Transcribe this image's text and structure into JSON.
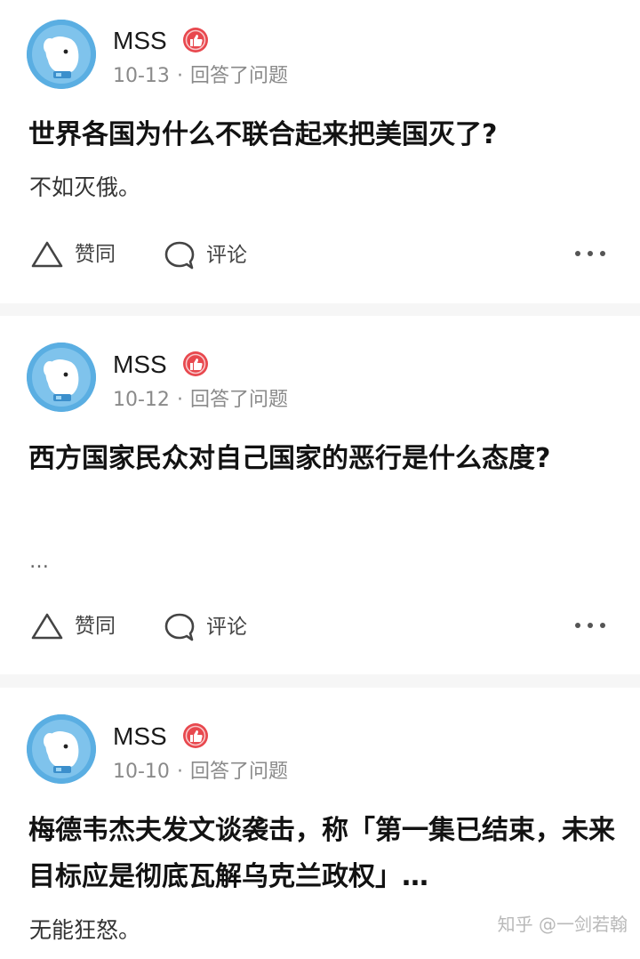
{
  "feed": [
    {
      "author": "MSS",
      "date": "10-13",
      "dot": "·",
      "action_text": "回答了问题",
      "question": "世界各国为什么不联合起来把美国灭了?",
      "excerpt": "不如灭俄。",
      "like_label": "赞同",
      "comment_label": "评论"
    },
    {
      "author": "MSS",
      "date": "10-12",
      "dot": "·",
      "action_text": "回答了问题",
      "question": "西方国家民众对自己国家的恶行是什么态度?",
      "excerpt": "…",
      "like_label": "赞同",
      "comment_label": "评论"
    },
    {
      "author": "MSS",
      "date": "10-10",
      "dot": "·",
      "action_text": "回答了问题",
      "question": "梅德韦杰夫发文谈袭击，称「第一集已结束，未来目标应是彻底瓦解乌克兰政权」…",
      "excerpt": "无能狂怒。"
    }
  ],
  "watermark": "知乎 @一剑若翰",
  "colors": {
    "badge": "#e8484e",
    "avatar_bg": "#5aaee2",
    "divider": "#f6f6f6"
  },
  "icons": {
    "like": "triangle-outline-icon",
    "comment": "speech-bubble-icon",
    "more": "ellipsis-icon",
    "badge": "thumbs-up-badge-icon"
  }
}
